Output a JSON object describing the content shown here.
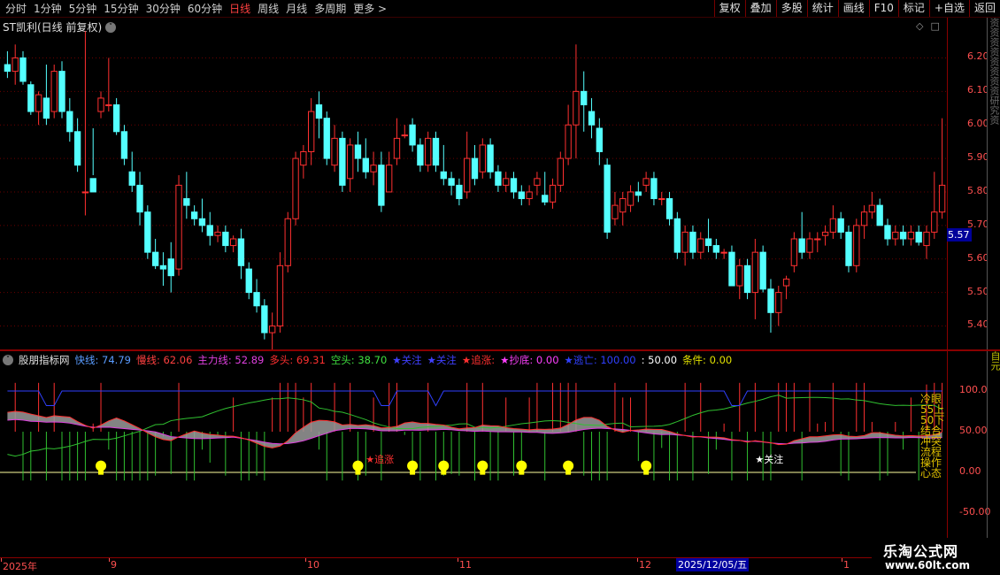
{
  "toolbar": {
    "periods": [
      "分时",
      "1分钟",
      "5分钟",
      "15分钟",
      "30分钟",
      "60分钟",
      "日线",
      "周线",
      "月线",
      "多周期",
      "更多 >"
    ],
    "active_period": "日线",
    "actions": [
      "复权",
      "叠加",
      "多股",
      "统计",
      "画线",
      "F10",
      "标记",
      "+自选",
      "返回"
    ]
  },
  "main_chart": {
    "title": "ST凯利(日线 前复权)",
    "current_price": "5.57",
    "side_strip_text": "资资资资资资资资研究资",
    "price_ticks": [
      "6.20",
      "6.10",
      "6.00",
      "5.90",
      "5.80",
      "5.70",
      "5.60",
      "5.50",
      "5.40"
    ],
    "colors": {
      "up": "#ff3030",
      "down": "#54ffff",
      "grid": "#7a0000"
    }
  },
  "indicator": {
    "name": "股朋指标网",
    "fields": [
      {
        "label": "快线:",
        "value": "74.79",
        "color": "#5a9cff"
      },
      {
        "label": "慢线:",
        "value": "62.06",
        "color": "#ff4040"
      },
      {
        "label": "主力线:",
        "value": "52.89",
        "color": "#e040e0"
      },
      {
        "label": "多头:",
        "value": "69.31",
        "color": "#ff3030"
      },
      {
        "label": "空头:",
        "value": "38.70",
        "color": "#40e040"
      },
      {
        "label": "★关注",
        "value": "",
        "color": "#4040ff"
      },
      {
        "label": "★关注",
        "value": "",
        "color": "#4040ff"
      },
      {
        "label": "★追涨:",
        "value": "",
        "color": "#ff3030"
      },
      {
        "label": "★抄底:",
        "value": "0.00",
        "color": "#ff40ff"
      },
      {
        "label": "★逃亡:",
        "value": "100.00",
        "color": "#3040ff"
      },
      {
        "label": ":",
        "value": "50.00",
        "color": "#ffffff"
      },
      {
        "label": "条件:",
        "value": "0.00",
        "color": "#e0e000"
      }
    ],
    "axis_ticks": [
      "100.0",
      "50.00",
      "0.00",
      "-50.00"
    ],
    "vertical_legend": "冷眼55上50下结合冲突流程操作心态",
    "side_text": "自元",
    "annotations": [
      {
        "text": "★追涨",
        "color": "#ff3030"
      },
      {
        "text": "★关注",
        "color": "#ffffff"
      },
      {
        "text": "★追涨",
        "color": "#ff3030"
      },
      {
        "text": "★关注",
        "color": "#4060ff"
      }
    ]
  },
  "date_axis": {
    "labels": [
      "2025年",
      "9",
      "10",
      "11",
      "12",
      "1"
    ],
    "highlight": "2025/12/05/五"
  },
  "watermark": {
    "title": "乐淘公式网",
    "url": "www.60lt.com"
  },
  "chart_data": {
    "type": "candlestick",
    "title": "ST凯利(日线 前复权)",
    "ylim": [
      5.33,
      6.32
    ],
    "candles": [
      [
        6.18,
        6.22,
        6.14,
        6.16
      ],
      [
        6.16,
        6.24,
        6.12,
        6.2
      ],
      [
        6.2,
        6.22,
        6.12,
        6.13
      ],
      [
        6.12,
        6.13,
        6.03,
        6.04
      ],
      [
        6.04,
        6.1,
        6.0,
        6.09
      ],
      [
        6.08,
        6.18,
        6.0,
        6.02
      ],
      [
        6.04,
        6.18,
        6.02,
        6.16
      ],
      [
        6.16,
        6.19,
        6.02,
        6.04
      ],
      [
        6.04,
        6.08,
        5.95,
        5.98
      ],
      [
        5.98,
        6.02,
        5.86,
        5.88
      ],
      [
        5.8,
        6.28,
        5.73,
        5.8
      ],
      [
        5.84,
        5.99,
        5.85,
        5.8
      ],
      [
        6.04,
        6.1,
        6.02,
        6.08
      ],
      [
        6.06,
        6.2,
        6.04,
        6.06
      ],
      [
        6.06,
        6.08,
        5.97,
        5.98
      ],
      [
        5.98,
        6.0,
        5.88,
        5.9
      ],
      [
        5.86,
        5.92,
        5.8,
        5.82
      ],
      [
        5.82,
        5.86,
        5.7,
        5.74
      ],
      [
        5.74,
        5.76,
        5.6,
        5.62
      ],
      [
        5.62,
        5.66,
        5.57,
        5.58
      ],
      [
        5.58,
        5.62,
        5.52,
        5.57
      ],
      [
        5.6,
        5.65,
        5.5,
        5.55
      ],
      [
        5.57,
        5.85,
        5.55,
        5.82
      ],
      [
        5.78,
        5.86,
        5.72,
        5.76
      ],
      [
        5.74,
        5.76,
        5.7,
        5.72
      ],
      [
        5.72,
        5.78,
        5.68,
        5.7
      ],
      [
        5.7,
        5.74,
        5.64,
        5.67
      ],
      [
        5.67,
        5.7,
        5.65,
        5.68
      ],
      [
        5.68,
        5.7,
        5.62,
        5.64
      ],
      [
        5.64,
        5.67,
        5.62,
        5.66
      ],
      [
        5.66,
        5.69,
        5.54,
        5.58
      ],
      [
        5.57,
        5.59,
        5.48,
        5.5
      ],
      [
        5.5,
        5.54,
        5.44,
        5.46
      ],
      [
        5.46,
        5.48,
        5.36,
        5.38
      ],
      [
        5.38,
        5.44,
        5.31,
        5.4
      ],
      [
        5.4,
        5.62,
        5.38,
        5.58
      ],
      [
        5.58,
        5.74,
        5.56,
        5.72
      ],
      [
        5.72,
        5.92,
        5.7,
        5.9
      ],
      [
        5.88,
        5.94,
        5.84,
        5.92
      ],
      [
        5.92,
        6.08,
        5.88,
        6.04
      ],
      [
        6.06,
        6.1,
        5.96,
        6.02
      ],
      [
        6.02,
        6.04,
        5.88,
        5.9
      ],
      [
        5.88,
        6.0,
        5.86,
        5.96
      ],
      [
        5.96,
        5.98,
        5.8,
        5.82
      ],
      [
        5.84,
        5.96,
        5.8,
        5.94
      ],
      [
        5.94,
        5.98,
        5.86,
        5.9
      ],
      [
        5.9,
        5.96,
        5.84,
        5.86
      ],
      [
        5.86,
        5.92,
        5.82,
        5.88
      ],
      [
        5.88,
        5.92,
        5.74,
        5.76
      ],
      [
        5.8,
        5.92,
        5.82,
        5.88
      ],
      [
        5.9,
        6.02,
        5.88,
        5.96
      ],
      [
        5.97,
        6.0,
        5.96,
        5.97
      ],
      [
        6.0,
        6.02,
        5.92,
        5.94
      ],
      [
        5.94,
        5.96,
        5.86,
        5.88
      ],
      [
        5.88,
        5.98,
        5.86,
        5.96
      ],
      [
        5.96,
        5.98,
        5.86,
        5.88
      ],
      [
        5.86,
        5.94,
        5.82,
        5.84
      ],
      [
        5.84,
        5.86,
        5.79,
        5.82
      ],
      [
        5.82,
        5.84,
        5.76,
        5.78
      ],
      [
        5.8,
        5.98,
        5.78,
        5.9
      ],
      [
        5.9,
        5.94,
        5.82,
        5.84
      ],
      [
        5.86,
        5.96,
        5.84,
        5.94
      ],
      [
        5.94,
        5.96,
        5.84,
        5.86
      ],
      [
        5.86,
        5.88,
        5.8,
        5.82
      ],
      [
        5.82,
        5.86,
        5.8,
        5.84
      ],
      [
        5.84,
        5.86,
        5.78,
        5.8
      ],
      [
        5.8,
        5.82,
        5.76,
        5.78
      ],
      [
        5.78,
        5.82,
        5.76,
        5.8
      ],
      [
        5.82,
        5.86,
        5.79,
        5.84
      ],
      [
        5.79,
        5.86,
        5.76,
        5.77
      ],
      [
        5.77,
        5.84,
        5.75,
        5.82
      ],
      [
        5.82,
        5.92,
        5.8,
        5.9
      ],
      [
        5.9,
        6.06,
        5.88,
        6.0
      ],
      [
        6.0,
        6.24,
        5.9,
        6.1
      ],
      [
        6.1,
        6.16,
        5.98,
        6.06
      ],
      [
        6.04,
        6.08,
        5.96,
        6.0
      ],
      [
        5.99,
        6.02,
        5.88,
        5.92
      ],
      [
        5.88,
        5.9,
        5.66,
        5.68
      ],
      [
        5.72,
        5.8,
        5.7,
        5.76
      ],
      [
        5.74,
        5.8,
        5.7,
        5.78
      ],
      [
        5.76,
        5.82,
        5.74,
        5.8
      ],
      [
        5.8,
        5.83,
        5.77,
        5.79
      ],
      [
        5.82,
        5.86,
        5.8,
        5.84
      ],
      [
        5.84,
        5.86,
        5.76,
        5.78
      ],
      [
        5.78,
        5.8,
        5.76,
        5.78
      ],
      [
        5.78,
        5.8,
        5.7,
        5.72
      ],
      [
        5.72,
        5.74,
        5.6,
        5.62
      ],
      [
        5.62,
        5.7,
        5.58,
        5.68
      ],
      [
        5.68,
        5.7,
        5.6,
        5.62
      ],
      [
        5.62,
        5.68,
        5.6,
        5.66
      ],
      [
        5.66,
        5.72,
        5.62,
        5.64
      ],
      [
        5.64,
        5.66,
        5.6,
        5.62
      ],
      [
        5.62,
        5.63,
        5.6,
        5.62
      ],
      [
        5.62,
        5.64,
        5.52,
        5.52
      ],
      [
        5.52,
        5.6,
        5.48,
        5.58
      ],
      [
        5.58,
        5.6,
        5.48,
        5.5
      ],
      [
        5.5,
        5.66,
        5.42,
        5.62
      ],
      [
        5.62,
        5.64,
        5.5,
        5.51
      ],
      [
        5.51,
        5.54,
        5.38,
        5.44
      ],
      [
        5.44,
        5.52,
        5.4,
        5.5
      ],
      [
        5.52,
        5.55,
        5.48,
        5.54
      ],
      [
        5.58,
        5.68,
        5.56,
        5.66
      ],
      [
        5.66,
        5.74,
        5.6,
        5.62
      ],
      [
        5.62,
        5.68,
        5.6,
        5.66
      ],
      [
        5.66,
        5.68,
        5.62,
        5.66
      ],
      [
        5.67,
        5.7,
        5.64,
        5.68
      ],
      [
        5.68,
        5.76,
        5.66,
        5.72
      ],
      [
        5.72,
        5.74,
        5.66,
        5.68
      ],
      [
        5.68,
        5.7,
        5.56,
        5.58
      ],
      [
        5.58,
        5.72,
        5.56,
        5.7
      ],
      [
        5.7,
        5.76,
        5.66,
        5.74
      ],
      [
        5.74,
        5.8,
        5.72,
        5.76
      ],
      [
        5.76,
        5.78,
        5.7,
        5.7
      ],
      [
        5.7,
        5.72,
        5.64,
        5.66
      ],
      [
        5.66,
        5.7,
        5.64,
        5.68
      ],
      [
        5.68,
        5.7,
        5.64,
        5.66
      ],
      [
        5.66,
        5.7,
        5.64,
        5.68
      ],
      [
        5.68,
        5.7,
        5.64,
        5.65
      ],
      [
        5.64,
        5.7,
        5.6,
        5.68
      ],
      [
        5.68,
        5.86,
        5.66,
        5.74
      ],
      [
        5.74,
        6.02,
        5.72,
        5.82
      ]
    ],
    "xlabels": [
      "2025年",
      "9",
      "10",
      "11",
      "12",
      "1"
    ]
  }
}
